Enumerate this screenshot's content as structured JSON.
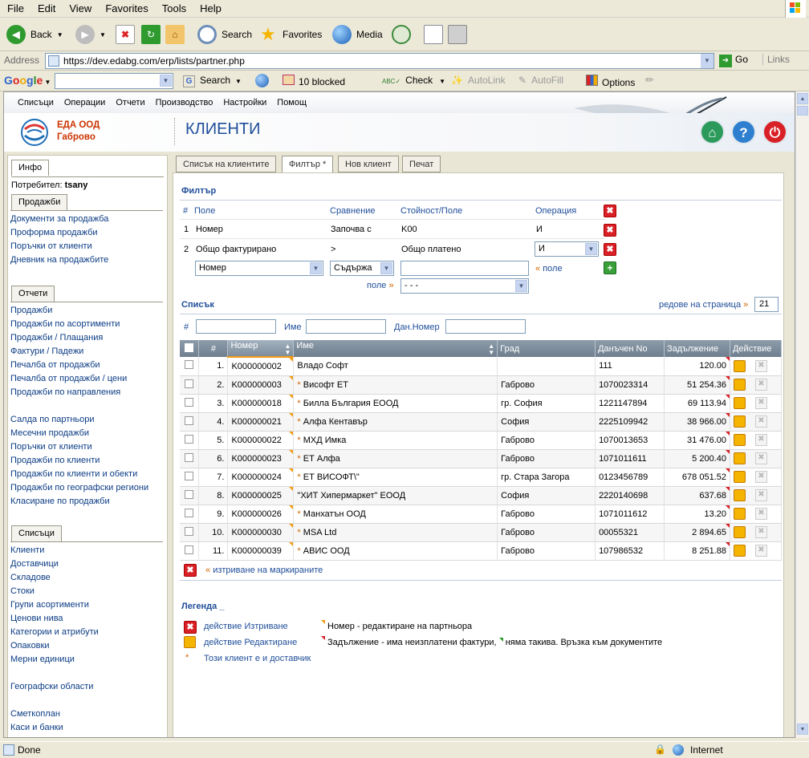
{
  "browser": {
    "menu": [
      "File",
      "Edit",
      "View",
      "Favorites",
      "Tools",
      "Help"
    ],
    "toolbar": {
      "back": "Back",
      "search": "Search",
      "favorites": "Favorites",
      "media": "Media"
    },
    "address_label": "Address",
    "url": "https://dev.edabg.com/erp/lists/partner.php",
    "go": "Go",
    "links": "Links",
    "google": {
      "search": "Search",
      "blocked": "10 blocked",
      "check": "Check",
      "autolink": "AutoLink",
      "autofill": "AutoFill",
      "options": "Options"
    },
    "status": {
      "text": "Done",
      "zone": "Internet"
    }
  },
  "app": {
    "menu": [
      "Списъци",
      "Операции",
      "Отчети",
      "Производство",
      "Настройки",
      "Помощ"
    ],
    "company": {
      "name": "ЕДА ООД",
      "city": "Габрово"
    },
    "title": "КЛИЕНТИ"
  },
  "sidebar": {
    "info_tab": "Инфо",
    "user_label": "Потребител:",
    "user": "tsany",
    "sales_tab": "Продажби",
    "sales": [
      "Документи за продажба",
      "Проформа продажби",
      "Поръчки от клиенти",
      "Дневник на продажбите"
    ],
    "reports_tab": "Отчети",
    "reports_a": [
      "Продажби",
      "Продажби по асортименти",
      "Продажби / Плащания",
      "Фактури / Падежи",
      "Печалба от продажби",
      "Печалба от продажби / цени",
      "Продажби по направления"
    ],
    "reports_b": [
      "Салда по партньори",
      "Месечни продажби",
      "Поръчки от клиенти",
      "Продажби по клиенти",
      "Продажби по клиенти и обекти",
      "Продажби по географски региони",
      "Класиране по продажби"
    ],
    "lists_tab": "Списъци",
    "lists_a": [
      "Клиенти",
      "Доставчици",
      "Складове",
      "Стоки",
      "Групи асортименти",
      "Ценови нива",
      "Категории и атрибути",
      "Опаковки",
      "Мерни единици"
    ],
    "lists_b": [
      "Географски области"
    ],
    "lists_c": [
      "Сметкоплан",
      "Каси и банки"
    ]
  },
  "tabs": [
    "Списък на клиентите",
    "Филтър *",
    "Нов клиент",
    "Печат"
  ],
  "filter": {
    "title": "Филтър",
    "headers": {
      "num": "#",
      "field": "Поле",
      "compare": "Сравнение",
      "value": "Стойност/Поле",
      "op": "Операция"
    },
    "rows": [
      {
        "n": "1",
        "field": "Номер",
        "compare": "Започва с",
        "value": "K00",
        "op": "И"
      },
      {
        "n": "2",
        "field": "Общо фактурирано",
        "compare": ">",
        "value": "Общо платено",
        "op": "И"
      }
    ],
    "new_field": "Номер",
    "new_compare": "Съдържа",
    "field_link": "поле",
    "field_link2": "поле",
    "field_select": "- - -"
  },
  "list": {
    "title": "Списък",
    "per_page_label": "редове на страница",
    "per_page": "21",
    "search": {
      "num": "#",
      "name": "Име",
      "tax": "Дан.Номер"
    },
    "columns": {
      "num": "#",
      "number": "Номер",
      "name": "Име",
      "city": "Град",
      "tax": "Данъчен No",
      "debt": "Задължение",
      "action": "Действие"
    },
    "rows": [
      {
        "n": "1.",
        "number": "K000000002",
        "name": "Владо Софт",
        "star": false,
        "city": "",
        "tax": "111",
        "debt": "120.00"
      },
      {
        "n": "2.",
        "number": "K000000003",
        "name": "Висофт ЕТ",
        "star": true,
        "city": "Габрово",
        "tax": "1070023314",
        "debt": "51 254.36"
      },
      {
        "n": "3.",
        "number": "K000000018",
        "name": "Билла България ЕООД",
        "star": true,
        "city": "гр. София",
        "tax": "1221147894",
        "debt": "69 113.94"
      },
      {
        "n": "4.",
        "number": "K000000021",
        "name": "Алфа Кентавър",
        "star": true,
        "city": "София",
        "tax": "2225109942",
        "debt": "38 966.00"
      },
      {
        "n": "5.",
        "number": "K000000022",
        "name": "МХД Имка",
        "star": true,
        "city": "Габрово",
        "tax": "1070013653",
        "debt": "31 476.00"
      },
      {
        "n": "6.",
        "number": "K000000023",
        "name": "ЕТ Алфа",
        "star": true,
        "city": "Габрово",
        "tax": "1071011611",
        "debt": "5 200.40"
      },
      {
        "n": "7.",
        "number": "K000000024",
        "name": "ЕТ ВИСОФТ\\\"",
        "star": true,
        "city": "гр. Стара Загора",
        "tax": "0123456789",
        "debt": "678 051.52"
      },
      {
        "n": "8.",
        "number": "K000000025",
        "name": "\"ХИТ Хипермаркет\" ЕООД",
        "star": false,
        "city": "София",
        "tax": "2220140698",
        "debt": "637.68"
      },
      {
        "n": "9.",
        "number": "K000000026",
        "name": "Манхатън ООД",
        "star": true,
        "city": "Габрово",
        "tax": "1071011612",
        "debt": "13.20"
      },
      {
        "n": "10.",
        "number": "K000000030",
        "name": "MSA Ltd",
        "star": true,
        "city": "Габрово",
        "tax": "00055321",
        "debt": "2 894.65"
      },
      {
        "n": "11.",
        "number": "K000000039",
        "name": "АВИС ООД",
        "star": true,
        "city": "Габрово",
        "tax": "107986532",
        "debt": "8 251.88"
      }
    ],
    "delete_marked": "изтриване на маркираните"
  },
  "legend": {
    "title": "Легенда _",
    "delete": "действие Изтриване",
    "edit": "действие Редактиране",
    "supplier": "Този клиент е и доставчик",
    "number_edit": "Номер - редактиране на партньора",
    "debt_a": "Задължение - има неизплатени фактури,",
    "debt_b": "няма такива. Връзка към документите"
  },
  "colors": {
    "title": "#1f4e99",
    "link": "#0b3c84",
    "accent": "#cc6600",
    "danger": "#d92027"
  }
}
